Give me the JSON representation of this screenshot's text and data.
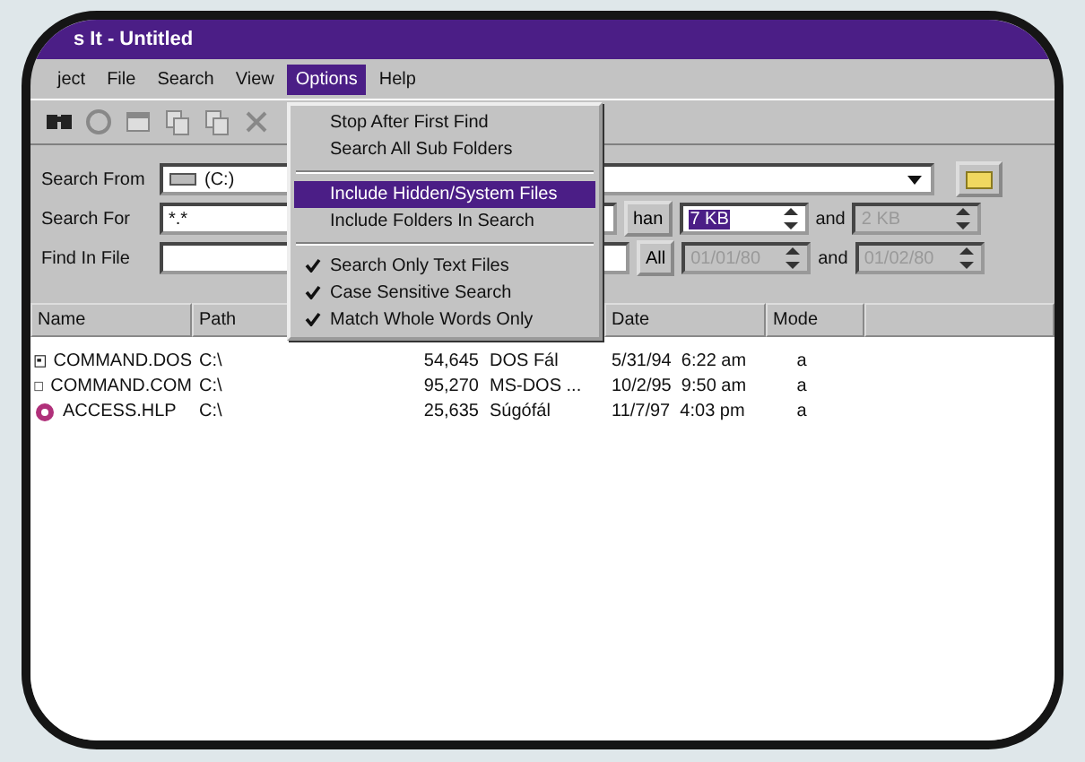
{
  "window": {
    "title": "s It - Untitled"
  },
  "menu_bar": [
    {
      "label": "ject",
      "selected": false
    },
    {
      "label": "File",
      "selected": false
    },
    {
      "label": "Search",
      "selected": false
    },
    {
      "label": "View",
      "selected": false
    },
    {
      "label": "Options",
      "selected": true
    },
    {
      "label": "Help",
      "selected": false
    }
  ],
  "options_menu": {
    "groups": [
      [
        {
          "label": "Stop After First Find",
          "checked": false,
          "selected": false
        },
        {
          "label": "Search All Sub Folders",
          "checked": false,
          "selected": false
        }
      ],
      [
        {
          "label": "Include Hidden/System Files",
          "checked": false,
          "selected": true
        },
        {
          "label": "Include Folders In Search",
          "checked": false,
          "selected": false
        }
      ],
      [
        {
          "label": "Search Only Text Files",
          "checked": true,
          "selected": false
        },
        {
          "label": "Case Sensitive Search",
          "checked": true,
          "selected": false
        },
        {
          "label": "Match Whole Words Only",
          "checked": true,
          "selected": false
        }
      ]
    ]
  },
  "search_from": {
    "label": "Search From",
    "value": "(C:)"
  },
  "search_for": {
    "label": "Search For",
    "value": "*.*",
    "size_button": "han",
    "size_min": {
      "value": "7 KB",
      "selected": true,
      "disabled": false
    },
    "and": "and",
    "size_max": {
      "value": "2 KB",
      "selected": false,
      "disabled": true
    }
  },
  "find_in_file": {
    "label": "Find In File",
    "date_button": "All",
    "date_from": {
      "value": "01/01/80",
      "selected": false,
      "disabled": true
    },
    "and": "and",
    "date_to": {
      "value": "01/02/80",
      "selected": false,
      "disabled": true
    }
  },
  "table": {
    "columns": [
      "Name",
      "Path",
      "Date",
      "Mode"
    ],
    "rows": [
      {
        "kind": "document",
        "name": "COMMAND.DOS",
        "path": "C:\\",
        "size": "54,645",
        "type": "DOS Fál",
        "date": "5/31/94  6:22 am",
        "mode": "a"
      },
      {
        "kind": "program",
        "name": "COMMAND.COM",
        "path": "C:\\",
        "size": "95,270",
        "type": "MS-DOS ...",
        "date": "10/2/95  9:50 am",
        "mode": "a"
      },
      {
        "kind": "help",
        "name": "ACCESS.HLP",
        "path": "C:\\",
        "size": "25,635",
        "type": "Súgófál",
        "date": "11/7/97  4:03 pm",
        "mode": "a"
      }
    ]
  }
}
